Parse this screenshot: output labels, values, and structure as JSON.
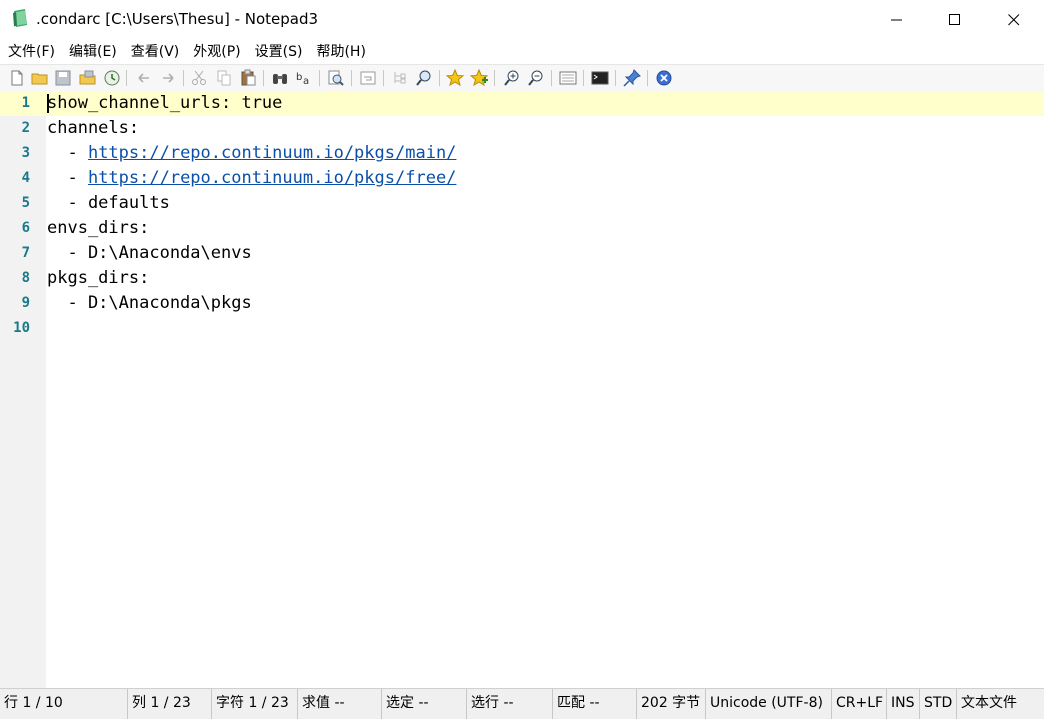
{
  "window": {
    "title": ".condarc [C:\\Users\\Thesu] - Notepad3"
  },
  "menu": {
    "items": [
      "文件(F)",
      "编辑(E)",
      "查看(V)",
      "外观(P)",
      "设置(S)",
      "帮助(H)"
    ]
  },
  "editor": {
    "lines": [
      {
        "num": "1",
        "text": "show_channel_urls: true"
      },
      {
        "num": "2",
        "text": "channels:"
      },
      {
        "num": "3",
        "prefix": "  - ",
        "url": "https://repo.continuum.io/pkgs/main/"
      },
      {
        "num": "4",
        "prefix": "  - ",
        "url": "https://repo.continuum.io/pkgs/free/"
      },
      {
        "num": "5",
        "text": "  - defaults"
      },
      {
        "num": "6",
        "text": "envs_dirs:"
      },
      {
        "num": "7",
        "text": "  - D:\\Anaconda\\envs"
      },
      {
        "num": "8",
        "text": "pkgs_dirs:"
      },
      {
        "num": "9",
        "text": "  - D:\\Anaconda\\pkgs"
      },
      {
        "num": "10",
        "text": ""
      }
    ]
  },
  "status": {
    "line": "行  1 / 10",
    "column": "列  1 / 23",
    "char": "字符  1 / 23",
    "value": "求值  --",
    "selection": "选定  --",
    "sel_lines": "选行  --",
    "match": "匹配  --",
    "size": "202 字节",
    "encoding": "Unicode (UTF-8)",
    "eol": "CR+LF",
    "ins": "INS",
    "std": "STD",
    "type": "文本文件"
  },
  "colors": {
    "current_line": "#ffffcc",
    "line_number": "#1a7a8a",
    "url": "#0b4fa8"
  }
}
